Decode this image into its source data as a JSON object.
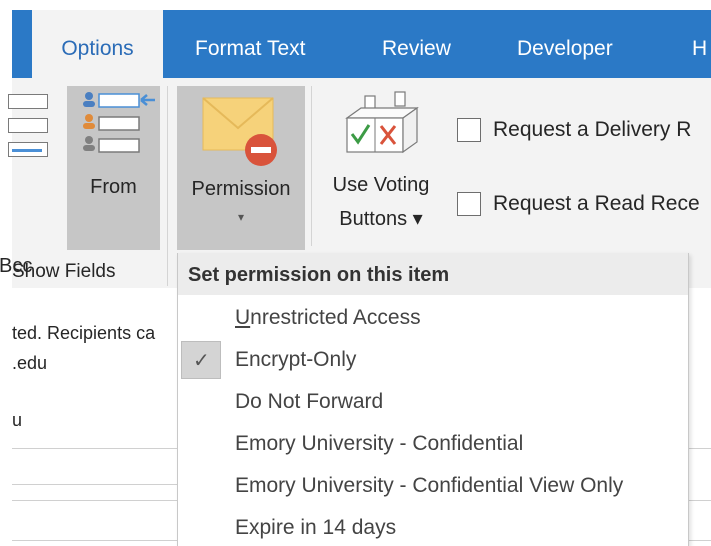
{
  "tabs": {
    "options": "Options",
    "format_text": "Format Text",
    "review": "Review",
    "developer": "Developer",
    "partial": "H"
  },
  "ribbon": {
    "bcc_label": "Bcc",
    "from_label": "From",
    "show_fields_label": "Show Fields",
    "permission_label": "Permission",
    "permission_caret": "▾",
    "voting_label_1": "Use Voting",
    "voting_label_2": "Buttons ▾",
    "request_delivery": "Request a Delivery R",
    "request_read": "Request a Read Rece"
  },
  "content": {
    "line1": "ted. Recipients ca",
    "line2": ".edu",
    "line3": "u"
  },
  "menu": {
    "header": "Set permission on this item",
    "items": [
      {
        "underline": "U",
        "rest": "nrestricted Access",
        "checked": false
      },
      {
        "label": "Encrypt-Only",
        "checked": true
      },
      {
        "label": "Do Not Forward",
        "checked": false
      },
      {
        "label": "Emory University - Confidential",
        "checked": false
      },
      {
        "label": "Emory University - Confidential View Only",
        "checked": false
      },
      {
        "label": "Expire in 14 days",
        "checked": false
      }
    ],
    "check_glyph": "✓"
  },
  "colors": {
    "tabbar": "#2b79c6",
    "ribbon": "#f3f3f3",
    "selected_button": "#c6c6c6",
    "envelope": "#f6d27a",
    "no_sign": "#d9533b"
  },
  "icons": [
    "envelope-no-sign-icon",
    "voting-ballot-icon",
    "from-people-icon",
    "check-mark-icon"
  ]
}
